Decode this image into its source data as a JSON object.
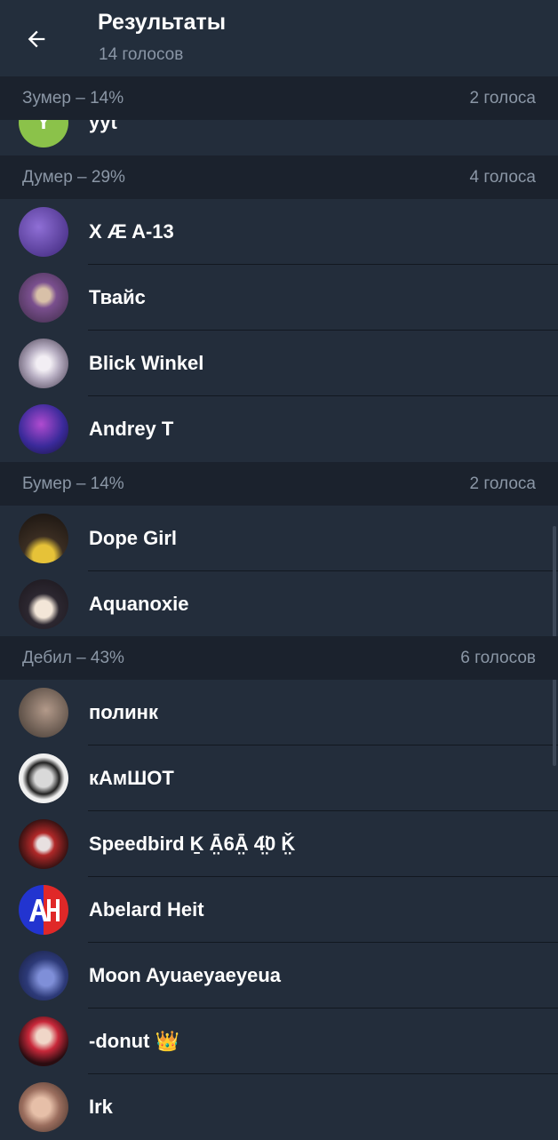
{
  "header": {
    "title": "Результаты",
    "subtitle": "14 голосов"
  },
  "sections": [
    {
      "label": "Зумер – 14%",
      "count": "2 голоса",
      "voters": [
        {
          "name": "yyt",
          "avatar_letter": "Y",
          "avatar_color": "#8bc24a"
        }
      ]
    },
    {
      "label": "Думер – 29%",
      "count": "4 голоса",
      "voters": [
        {
          "name": "X Æ A-13",
          "avatar_color": "#5b3f9e"
        },
        {
          "name": "Твайс",
          "avatar_color": "#6d4d7a"
        },
        {
          "name": "Blick Winkel",
          "avatar_color": "#c9c2cf"
        },
        {
          "name": "Andrey T",
          "avatar_color": "#3d2f86"
        }
      ]
    },
    {
      "label": "Бумер – 14%",
      "count": "2 голоса",
      "voters": [
        {
          "name": "Dope Girl",
          "avatar_color": "#2a2118"
        },
        {
          "name": "Aquanoxie",
          "avatar_color": "#2b2631"
        }
      ]
    },
    {
      "label": "Дебил – 43%",
      "count": "6 голосов",
      "voters": [
        {
          "name": "полинк",
          "avatar_color": "#8a7a70"
        },
        {
          "name": "кАмШОТ",
          "avatar_color": "#e6e6e6"
        },
        {
          "name": "Speedbird Ḵ Ā̤6Ā̤ 4̤̈0 Ǩ̤",
          "avatar_color": "#5a2424"
        },
        {
          "name": "Abelard Heit",
          "avatar_color": "#2a3fc4"
        },
        {
          "name": "Moon Ayuaeyaeyeua",
          "avatar_color": "#2d3a78"
        },
        {
          "name": "-donut 👑",
          "avatar_color": "#3a1414"
        },
        {
          "name": "Irk",
          "avatar_color": "#c89b85"
        }
      ]
    }
  ]
}
